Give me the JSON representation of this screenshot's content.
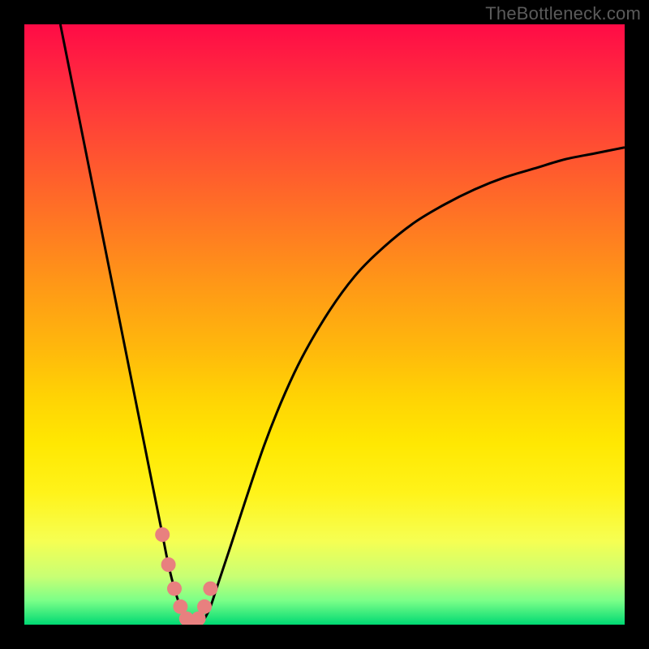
{
  "watermark": "TheBottleneck.com",
  "chart_data": {
    "type": "line",
    "title": "",
    "xlabel": "",
    "ylabel": "",
    "xlim": [
      0,
      100
    ],
    "ylim": [
      0,
      100
    ],
    "grid": false,
    "legend": false,
    "series": [
      {
        "name": "bottleneck-curve",
        "x": [
          6,
          8,
          10,
          12,
          14,
          16,
          18,
          20,
          22,
          23,
          24,
          25,
          26,
          27,
          28,
          29,
          30,
          31,
          32,
          34,
          40,
          45,
          50,
          55,
          60,
          65,
          70,
          75,
          80,
          85,
          90,
          95,
          100
        ],
        "y": [
          100,
          90,
          80,
          70,
          60,
          50,
          40,
          30,
          20,
          15,
          10,
          6,
          3,
          1,
          0,
          0,
          1,
          3,
          6,
          12,
          30,
          42,
          51,
          58,
          63,
          67,
          70,
          72.5,
          74.5,
          76,
          77.5,
          78.5,
          79.5
        ]
      }
    ],
    "markers": {
      "name": "highlight-dots",
      "x": [
        23,
        24,
        25,
        26,
        27,
        28,
        29,
        30,
        31
      ],
      "y": [
        15,
        10,
        6,
        3,
        1,
        0,
        1,
        3,
        6
      ],
      "color": "#e8807f",
      "size": 9
    },
    "background_gradient": {
      "direction": "vertical",
      "stops": [
        {
          "pos": 0.0,
          "color": "#ff0b46"
        },
        {
          "pos": 0.14,
          "color": "#ff3a3a"
        },
        {
          "pos": 0.34,
          "color": "#ff7a22"
        },
        {
          "pos": 0.54,
          "color": "#ffb80c"
        },
        {
          "pos": 0.7,
          "color": "#ffe802"
        },
        {
          "pos": 0.86,
          "color": "#f6ff52"
        },
        {
          "pos": 0.96,
          "color": "#7bff88"
        },
        {
          "pos": 1.0,
          "color": "#00d973"
        }
      ]
    }
  }
}
